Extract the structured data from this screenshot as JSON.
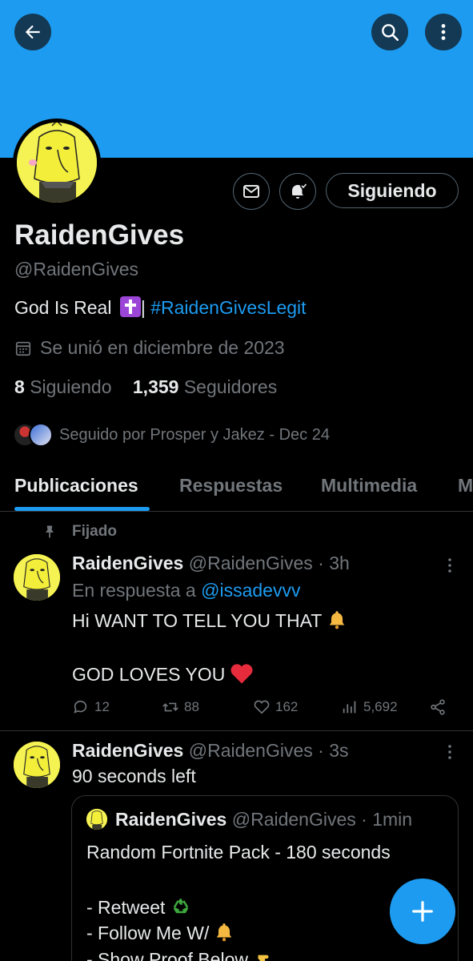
{
  "profile": {
    "name": "RaidenGives",
    "handle": "@RaidenGives",
    "bio_text": "God Is Real ",
    "bio_separator": "|",
    "bio_hashtag": "#RaidenGivesLegit",
    "joined": "Se unió en diciembre de 2023",
    "following_count": "8",
    "following_label": "Siguiendo",
    "followers_count": "1,359",
    "followers_label": "Seguidores",
    "followed_by": "Seguido por Prosper y Jakez - Dec 24",
    "follow_button": "Siguiendo"
  },
  "tabs": [
    {
      "label": "Publicaciones",
      "active": true
    },
    {
      "label": "Respuestas"
    },
    {
      "label": "Multimedia"
    },
    {
      "label": "M"
    }
  ],
  "tweet1": {
    "pinned_label": "Fijado",
    "name": "RaidenGives",
    "handle": "@RaidenGives",
    "time": "· 3h",
    "reply_prefix": "En respuesta a ",
    "reply_to": "@issadevvv",
    "line1": "Hi WANT TO TELL YOU THAT",
    "line2": "GOD LOVES YOU",
    "replies": "12",
    "retweets": "88",
    "likes": "162",
    "views": "5,692"
  },
  "tweet2": {
    "name": "RaidenGives",
    "handle": "@RaidenGives",
    "time": "· 3s",
    "text": "90 seconds left",
    "quote": {
      "name": "RaidenGives",
      "handle": "@RaidenGives",
      "time": "· 1min",
      "line1": "Random Fortnite Pack - 180 seconds",
      "line2": "- Retweet",
      "line3": "- Follow Me W/",
      "line4": "- Show Proof Below"
    }
  },
  "colors": {
    "banner": "#1d9bf0",
    "accent": "#1d9bf0",
    "background": "#000000",
    "muted": "#71767b"
  },
  "icons": [
    "back-arrow-icon",
    "search-icon",
    "more-vertical-icon",
    "mail-icon",
    "bell-check-icon",
    "calendar-icon",
    "pin-icon",
    "reply-icon",
    "retweet-icon",
    "like-icon",
    "views-icon",
    "share-icon",
    "plus-icon"
  ]
}
